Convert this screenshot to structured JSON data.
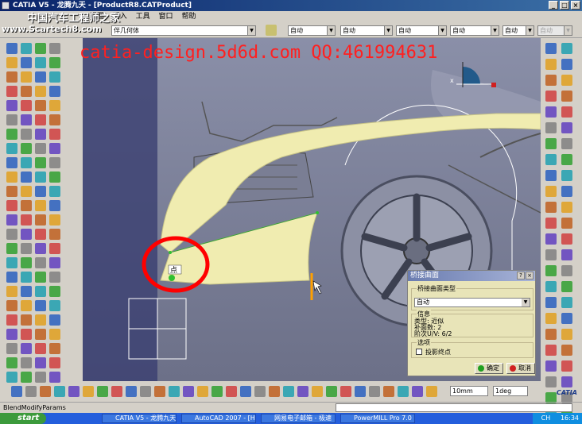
{
  "window": {
    "title": "CATIA V5 - 龙腾九天 - [ProductR8.CATProduct]"
  },
  "menu": {
    "items": [
      "视图",
      "插入",
      "工具",
      "窗口",
      "帮助"
    ]
  },
  "toolbar": {
    "part_combo": "伴几何体",
    "combos": [
      "自动",
      "自动",
      "自动",
      "自动",
      "自动",
      "自动"
    ],
    "disabled_combo": "自动"
  },
  "watermarks": {
    "main": "catia-design.5d6d.com QQ:461994631",
    "site": "www.Scartech8.com",
    "banner": "中国汽车工程师之家"
  },
  "viewport": {
    "point_label": "点"
  },
  "dialog": {
    "title": "桥接曲面",
    "type_group": "桥接曲面类型",
    "type_value": "自动",
    "info_group": "信息",
    "info_lines": [
      "类型: 近似",
      "补面数: 2",
      "阶次U/V: 6/2"
    ],
    "options_group": "选项",
    "checkbox_label": "投影终点",
    "ok_label": "确定",
    "cancel_label": "取消"
  },
  "bottom_toolbar": {
    "length_field": "10mm",
    "angle_field": "1deg",
    "logo": "CATIA"
  },
  "status": {
    "text": "BlendModifyParams"
  },
  "taskbar": {
    "start": "start",
    "tasks": [
      "CATIA V5 - 龙腾九天",
      "AutoCAD 2007 - [H:\\t",
      "网易电子邮箱 - 极速",
      "PowerMILL Pro 7.0"
    ],
    "lang": "CH",
    "clock": "16:34"
  },
  "colors": {
    "surface": "#f0ecb0",
    "viewport_bg": "#7a7f9a",
    "circle_mark": "#ff0000",
    "title_bg": "#0a246a"
  }
}
